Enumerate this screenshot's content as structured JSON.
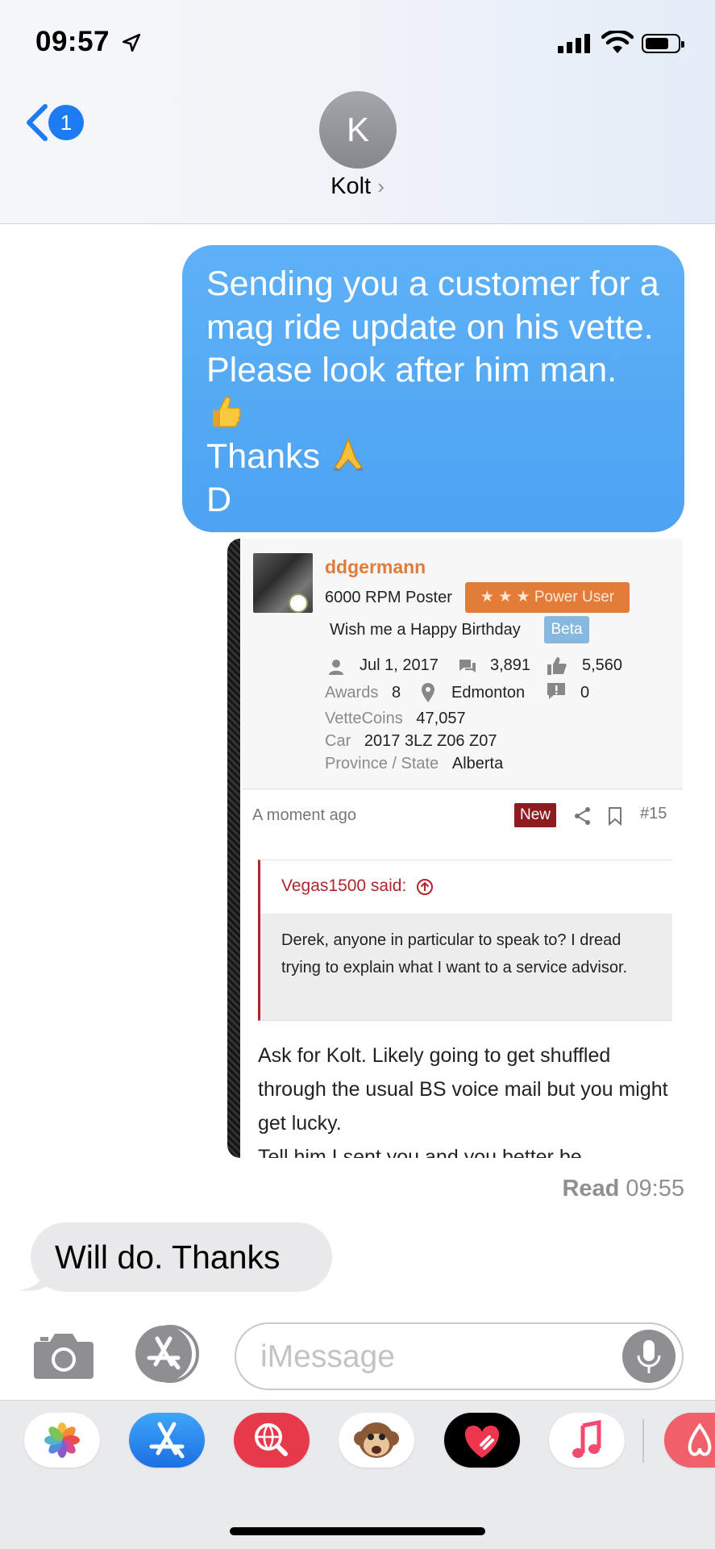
{
  "status_bar": {
    "time": "09:57"
  },
  "header": {
    "back_badge": "1",
    "avatar_initial": "K",
    "contact_name": "Kolt",
    "contact_chevron": "›"
  },
  "messages": {
    "sent_text": "Sending you a customer for a mag ride update on his vette. Please look after him man.",
    "sent_thanks": "Thanks",
    "sent_sign": "D",
    "emoji_1": "thumbs-up",
    "emoji_2": "folded-hands",
    "read_label": "Read",
    "read_time": "09:55",
    "received_text": "Will do.  Thanks"
  },
  "forum_card": {
    "username": "ddgermann",
    "user_title": "6000 RPM Poster",
    "rank_badge": "★ ★ ★ Power User",
    "birthday": "Wish me a Happy Birthday",
    "beta_badge": "Beta",
    "joined": "Jul 1, 2017",
    "messages": "3,891",
    "likes": "5,560",
    "awards_label": "Awards",
    "awards": "8",
    "location": "Edmonton",
    "warnings": "0",
    "vettecoins_label": "VetteCoins",
    "vettecoins": "47,057",
    "car_label": "Car",
    "car": "2017 3LZ Z06 Z07",
    "province_label": "Province / State",
    "province": "Alberta",
    "time_ago": "A moment ago",
    "new_badge": "New",
    "post_number": "#15",
    "quote_author": "Vegas1500 said:",
    "quote_text": "Derek, anyone in particular to speak to? I dread trying to explain what I want to a service advisor.",
    "reply_text": "Ask for Kolt. Likely going to get shuffled through the usual BS voice mail but you might get lucky.",
    "reply_cut": "Tell him I sent you and you better be"
  },
  "input": {
    "placeholder": "iMessage"
  },
  "app_drawer": {
    "apps": [
      "photos-app",
      "app-store-app",
      "search-images-app",
      "animoji-app",
      "digital-touch-app",
      "music-app",
      "airbnb-app"
    ]
  },
  "colors": {
    "imessage_blue": "#4da3f2",
    "accent_blue": "#1e7cf2",
    "forum_orange": "#e07b3a",
    "quote_red": "#b0242c"
  }
}
